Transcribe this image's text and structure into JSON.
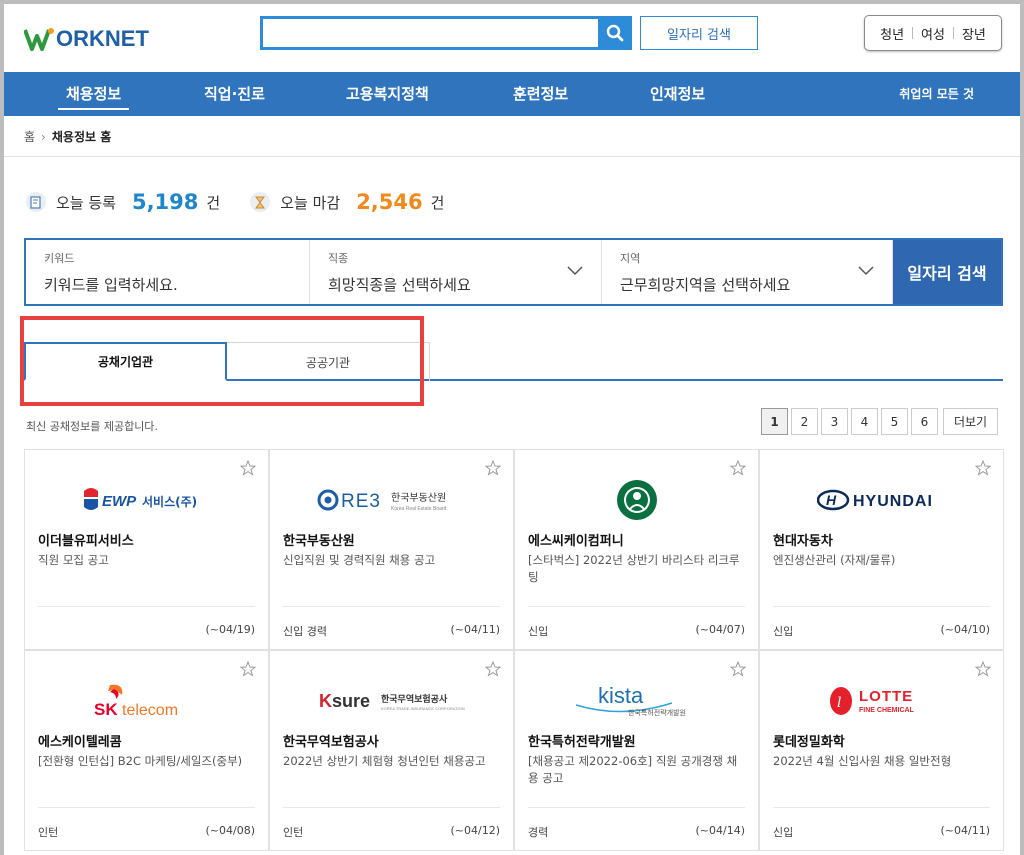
{
  "header": {
    "logo_text": "ORKNET",
    "search": {
      "value": "",
      "placeholder": ""
    },
    "job_search_label": "일자리 검색",
    "target_links": [
      "청년",
      "여성",
      "장년"
    ]
  },
  "nav": {
    "items": [
      "채용정보",
      "직업·진로",
      "고용복지정책",
      "훈련정보",
      "인재정보"
    ],
    "active": "채용정보",
    "right_link": "취업의 모든 것"
  },
  "breadcrumb": {
    "home": "홈",
    "current": "채용정보 홈"
  },
  "stats": {
    "today_registered_label": "오늘 등록",
    "today_registered_value": "5,198",
    "today_deadline_label": "오늘 마감",
    "today_deadline_value": "2,546",
    "unit": "건"
  },
  "search_form": {
    "keyword_label": "키워드",
    "keyword_placeholder": "키워드를 입력하세요.",
    "job_label": "직종",
    "job_value": "희망직종을 선택하세요",
    "region_label": "지역",
    "region_value": "근무희망지역을 선택하세요",
    "submit_label": "일자리 검색"
  },
  "tabs": [
    {
      "label": "공채기업관",
      "active": true
    },
    {
      "label": "공공기관",
      "active": false
    }
  ],
  "info_text": "최신 공채정보를 제공합니다.",
  "pagination": {
    "pages": [
      "1",
      "2",
      "3",
      "4",
      "5",
      "6"
    ],
    "current": "1",
    "more_label": "더보기"
  },
  "cards": [
    {
      "logo": "EWP서비스(주)",
      "company": "이더블유피서비스",
      "title": "직원 모집 공고",
      "type": "",
      "deadline": "(~04/19)"
    },
    {
      "logo": "RE3 한국부동산원",
      "company": "한국부동산원",
      "title": "신입직원 및 경력직원 채용 공고",
      "type": "신입 경력",
      "deadline": "(~04/11)"
    },
    {
      "logo": "starbucks",
      "company": "에스씨케이컴퍼니",
      "title": "[스타벅스] 2022년 상반기 바리스타 리크루팅",
      "type": "신입",
      "deadline": "(~04/07)"
    },
    {
      "logo": "HYUNDAI",
      "company": "현대자동차",
      "title": "엔진생산관리 (자재/물류)",
      "type": "신입",
      "deadline": "(~04/10)"
    },
    {
      "logo": "SK telecom",
      "company": "에스케이텔레콤",
      "title": "[전환형 인턴십] B2C 마케팅/세일즈(중부)",
      "type": "인턴",
      "deadline": "(~04/08)"
    },
    {
      "logo": "K-sure 한국무역보험공사",
      "company": "한국무역보험공사",
      "title": "2022년 상반기 체험형 청년인턴 채용공고",
      "type": "인턴",
      "deadline": "(~04/12)"
    },
    {
      "logo": "kista 한국특허전략개발원",
      "company": "한국특허전략개발원",
      "title": "[채용공고 제2022-06호] 직원 공개경쟁 채용 공고",
      "type": "경력",
      "deadline": "(~04/14)"
    },
    {
      "logo": "LOTTE FINE CHEMICAL",
      "company": "롯데정밀화학",
      "title": "2022년 4월 신입사원 채용 일반전형",
      "type": "신입",
      "deadline": "(~04/11)"
    }
  ],
  "colors": {
    "brand_blue": "#2f74bd",
    "accent_blue": "#1f86cc",
    "accent_orange": "#f08a1c",
    "highlight_red": "#e8403f"
  }
}
